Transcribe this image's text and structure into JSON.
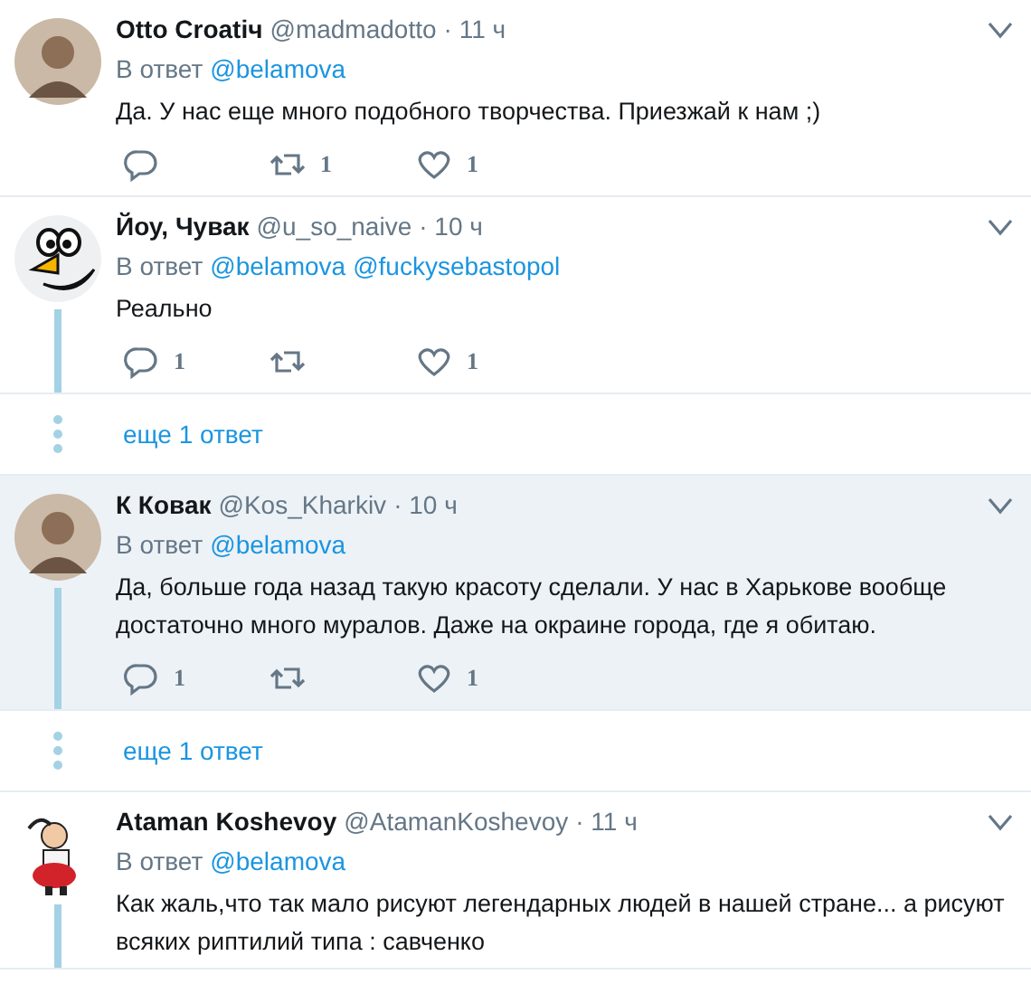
{
  "tweets": [
    {
      "name": "Otto Croatiч",
      "handle": "@madmadotto",
      "time": "· 11 ч",
      "reply_label": "В ответ",
      "mentions": [
        "@belamova"
      ],
      "text": "Да. У нас еще много подобного творчества. Приезжай к нам ;)",
      "threaded": false,
      "highlighted": false,
      "avatar": {
        "kind": "person"
      },
      "actions": [
        {
          "kind": "reply"
        },
        {
          "kind": "retweet",
          "count": "1"
        },
        {
          "kind": "like",
          "count": "1"
        }
      ]
    },
    {
      "name": "Йоу, Чувак",
      "handle": "@u_so_naive",
      "time": "· 10 ч",
      "reply_label": "В ответ",
      "mentions": [
        "@belamova",
        "@fuckysebastopol"
      ],
      "text": "Реально",
      "threaded": true,
      "highlighted": false,
      "avatar": {
        "kind": "bird"
      },
      "actions": [
        {
          "kind": "reply",
          "count": "1"
        },
        {
          "kind": "retweet"
        },
        {
          "kind": "like",
          "count": "1"
        }
      ],
      "more": "еще 1 ответ"
    },
    {
      "name": "К Ковак",
      "handle": "@Kos_Kharkiv",
      "time": "· 10 ч",
      "reply_label": "В ответ",
      "mentions": [
        "@belamova"
      ],
      "text": "Да, больше года назад такую красоту сделали. У нас в Харькове вообще достаточно много муралов. Даже на окраине города, где я обитаю.",
      "threaded": true,
      "highlighted": true,
      "avatar": {
        "kind": "person"
      },
      "actions": [
        {
          "kind": "reply",
          "count": "1"
        },
        {
          "kind": "retweet"
        },
        {
          "kind": "like",
          "count": "1"
        }
      ],
      "more": "еще 1 ответ"
    },
    {
      "name": "Ataman Koshevoy",
      "handle": "@AtamanKoshevoy",
      "time": "· 11 ч",
      "reply_label": "В ответ",
      "mentions": [
        "@belamova"
      ],
      "text": "Как жаль,что так мало рисуют легендарных людей в нашей стране... а рисуют всяких риптилий типа : савченко",
      "threaded": true,
      "highlighted": false,
      "avatar": {
        "kind": "cartoon"
      }
    }
  ]
}
